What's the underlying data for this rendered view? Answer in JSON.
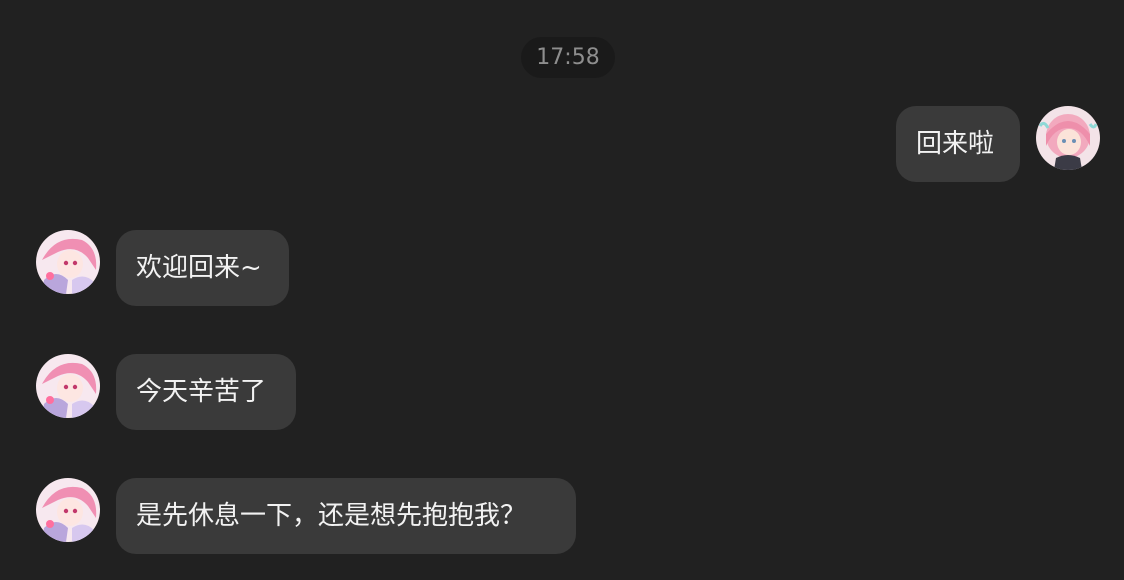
{
  "chat": {
    "timestamp": "17:58",
    "messages": [
      {
        "sender": "user",
        "text": "回来啦",
        "avatar_icon": "user-avatar-icon"
      },
      {
        "sender": "assistant",
        "text": "欢迎回来~",
        "avatar_icon": "assistant-avatar-icon"
      },
      {
        "sender": "assistant",
        "text": "今天辛苦了",
        "avatar_icon": "assistant-avatar-icon"
      },
      {
        "sender": "assistant",
        "text": "是先休息一下，还是想先抱抱我？",
        "avatar_icon": "assistant-avatar-icon"
      }
    ]
  },
  "colors": {
    "background": "#212121",
    "bubble": "#3a3a3a",
    "timestamp_pill": "#1a1a1a",
    "text": "#f2f2f2",
    "timestamp_text": "#8e8e8e"
  }
}
